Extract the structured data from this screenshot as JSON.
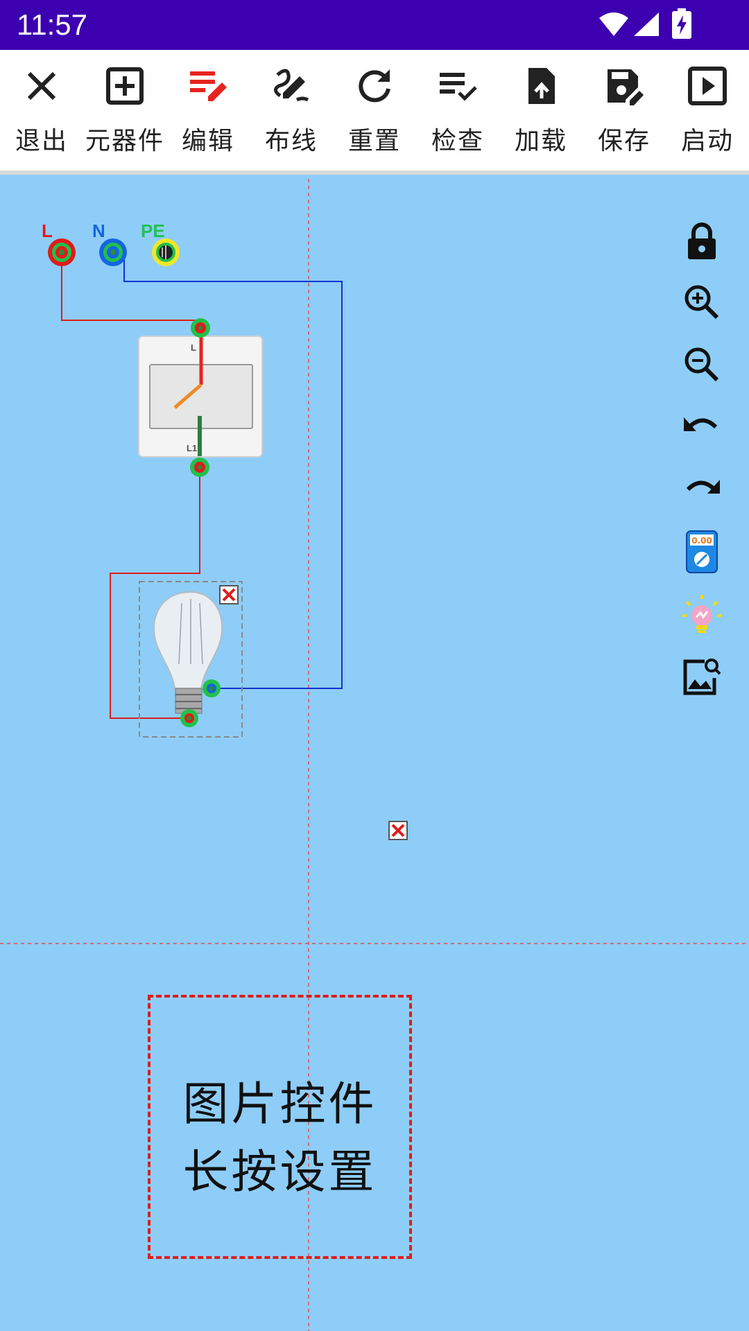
{
  "status_bar": {
    "time": "11:57"
  },
  "toolbar": {
    "items": [
      {
        "label": "退出",
        "icon": "close-icon"
      },
      {
        "label": "元器件",
        "icon": "add-box-icon"
      },
      {
        "label": "编辑",
        "icon": "edit-list-icon",
        "active": true
      },
      {
        "label": "布线",
        "icon": "draw-wire-icon"
      },
      {
        "label": "重置",
        "icon": "refresh-icon"
      },
      {
        "label": "检查",
        "icon": "checklist-icon"
      },
      {
        "label": "加载",
        "icon": "upload-file-icon"
      },
      {
        "label": "保存",
        "icon": "save-edit-icon"
      },
      {
        "label": "启动",
        "icon": "play-icon"
      }
    ]
  },
  "canvas": {
    "terminals": {
      "l": "L",
      "n": "N",
      "pe": "PE"
    },
    "switch": {
      "top_label": "L",
      "bottom_label": "L1"
    },
    "multimeter_display": "0.00",
    "image_widget": {
      "line1": "图片控件",
      "line2": "长按设置"
    }
  },
  "side_tools": [
    "lock-icon",
    "zoom-in-icon",
    "zoom-out-icon",
    "undo-icon",
    "redo-icon",
    "multimeter-icon",
    "bulb-tip-icon",
    "image-search-icon"
  ],
  "colors": {
    "status_bar": "#3d00b0",
    "canvas_bg": "#8ecdf7",
    "live_wire": "#e01b1b",
    "neutral_wire": "#1030d0",
    "active_tool": "#e8231e"
  }
}
